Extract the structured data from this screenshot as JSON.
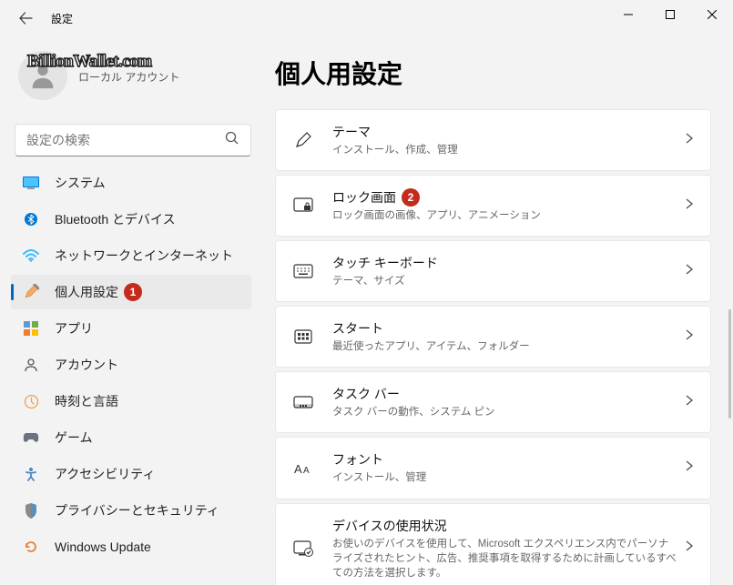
{
  "window": {
    "title": "設定"
  },
  "profile": {
    "account_type": "ローカル アカウント",
    "watermark": "BillionWallet.com"
  },
  "search": {
    "placeholder": "設定の検索"
  },
  "sidebar": {
    "items": [
      {
        "label": "システム"
      },
      {
        "label": "Bluetooth とデバイス"
      },
      {
        "label": "ネットワークとインターネット"
      },
      {
        "label": "個人用設定",
        "badge": "1"
      },
      {
        "label": "アプリ"
      },
      {
        "label": "アカウント"
      },
      {
        "label": "時刻と言語"
      },
      {
        "label": "ゲーム"
      },
      {
        "label": "アクセシビリティ"
      },
      {
        "label": "プライバシーとセキュリティ"
      },
      {
        "label": "Windows Update"
      }
    ]
  },
  "main": {
    "title": "個人用設定",
    "cards": [
      {
        "title": "テーマ",
        "desc": "インストール、作成、管理"
      },
      {
        "title": "ロック画面",
        "badge": "2",
        "desc": "ロック画面の画像、アプリ、アニメーション"
      },
      {
        "title": "タッチ キーボード",
        "desc": "テーマ、サイズ"
      },
      {
        "title": "スタート",
        "desc": "最近使ったアプリ、アイテム、フォルダー"
      },
      {
        "title": "タスク バー",
        "desc": "タスク バーの動作、システム ピン"
      },
      {
        "title": "フォント",
        "desc": "インストール、管理"
      },
      {
        "title": "デバイスの使用状況",
        "desc": "お使いのデバイスを使用して、Microsoft エクスペリエンス内でパーソナライズされたヒント、広告、推奨事項を取得するために計画しているすべての方法を選択します。"
      }
    ]
  }
}
